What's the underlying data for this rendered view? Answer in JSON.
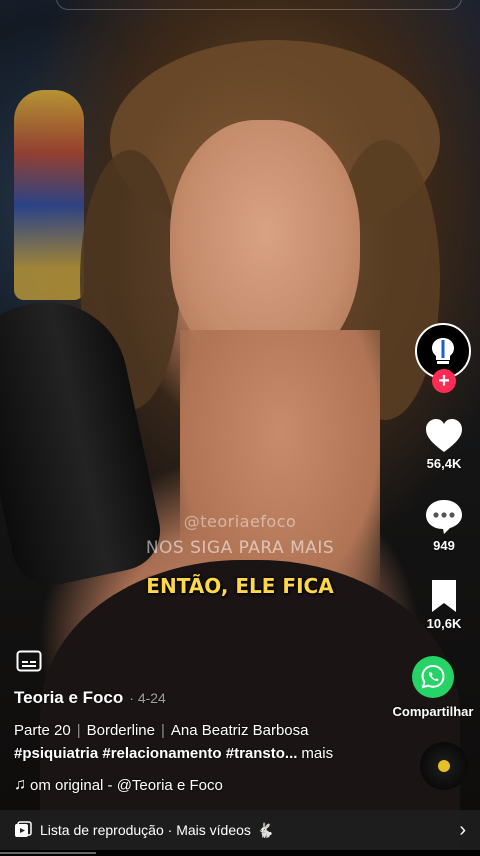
{
  "video": {
    "watermark_handle": "@teoriaefoco",
    "watermark_text": "NOS SIGA PARA MAIS",
    "caption": "ENTÃO, ELE FICA"
  },
  "rail": {
    "avatar_icon": "brain-lightbulb-icon",
    "follow_icon": "plus-icon",
    "likes": "56,4K",
    "comments": "949",
    "saves": "10,6K",
    "share_label": "Compartilhar",
    "sound_disc_icon": "music-disc-icon"
  },
  "post": {
    "author": "Teoria e Foco",
    "date": "· 4-24",
    "desc_part": "Parte 20",
    "desc_topic": "Borderline",
    "desc_person": "Ana Beatriz Barbosa",
    "hashtags": "#psiquiatria #relacionamento #transto...",
    "more": "mais",
    "sound": "om original - @Teoria e Foco"
  },
  "playlist": {
    "label": "Lista de reprodução · Mais vídeos",
    "emoji": "🐇"
  },
  "colors": {
    "caption": "#ffd84a",
    "like_red": "#fe2c55",
    "whatsapp": "#25d366"
  },
  "progress": 0.2
}
